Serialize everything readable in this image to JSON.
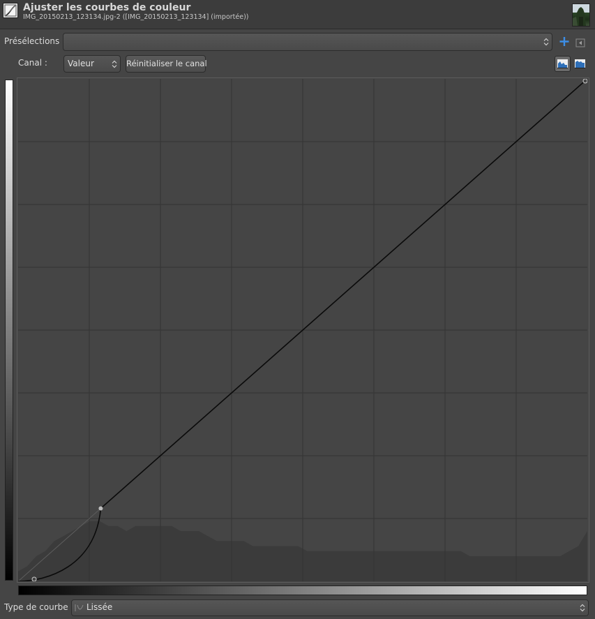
{
  "header": {
    "title": "Ajuster les courbes de couleur",
    "subtitle": "IMG_20150213_123134.jpg-2 ([IMG_20150213_123134] (importée))",
    "icon": "curves-tool-icon",
    "thumbnail": "image-thumbnail"
  },
  "presets": {
    "label": "Présélections :",
    "value": "",
    "add_icon": "plus-icon",
    "menu_icon": "menu-arrow-icon"
  },
  "channel": {
    "label": "Canal :",
    "value": "Valeur",
    "reset_label": "Réinitialiser le canal",
    "linear_histogram_icon": "linear-histogram-icon",
    "log_histogram_icon": "logarithmic-histogram-icon"
  },
  "curve_type": {
    "label": "Type de courbe :",
    "value": "Lissée",
    "icon": "smooth-curve-icon"
  },
  "colors": {
    "background": "#454545",
    "grid": "#333333",
    "curve": "#0a0a0a",
    "diagonal": "#5e5e5e",
    "histogram": "#3b3b3b",
    "accent_blue": "#3d8ee6"
  },
  "curve": {
    "range": [
      0,
      255
    ],
    "control_points": [
      [
        0,
        0
      ],
      [
        29,
        10
      ],
      [
        37,
        37
      ],
      [
        255,
        255
      ]
    ],
    "selected_point_index": 2
  },
  "histogram": {
    "bins": [
      2,
      3,
      5,
      6,
      8,
      9,
      10,
      11,
      12,
      12,
      11,
      11,
      10,
      11,
      11,
      11,
      11,
      11,
      10,
      10,
      10,
      9,
      8,
      8,
      8,
      8,
      7,
      7,
      7,
      7,
      7,
      7,
      6,
      6,
      6,
      6,
      6,
      6,
      6,
      6,
      6,
      6,
      6,
      6,
      6,
      6,
      6,
      6,
      6,
      6,
      5,
      5,
      5,
      5,
      5,
      5,
      5,
      5,
      5,
      5,
      5,
      6,
      7,
      10
    ]
  }
}
